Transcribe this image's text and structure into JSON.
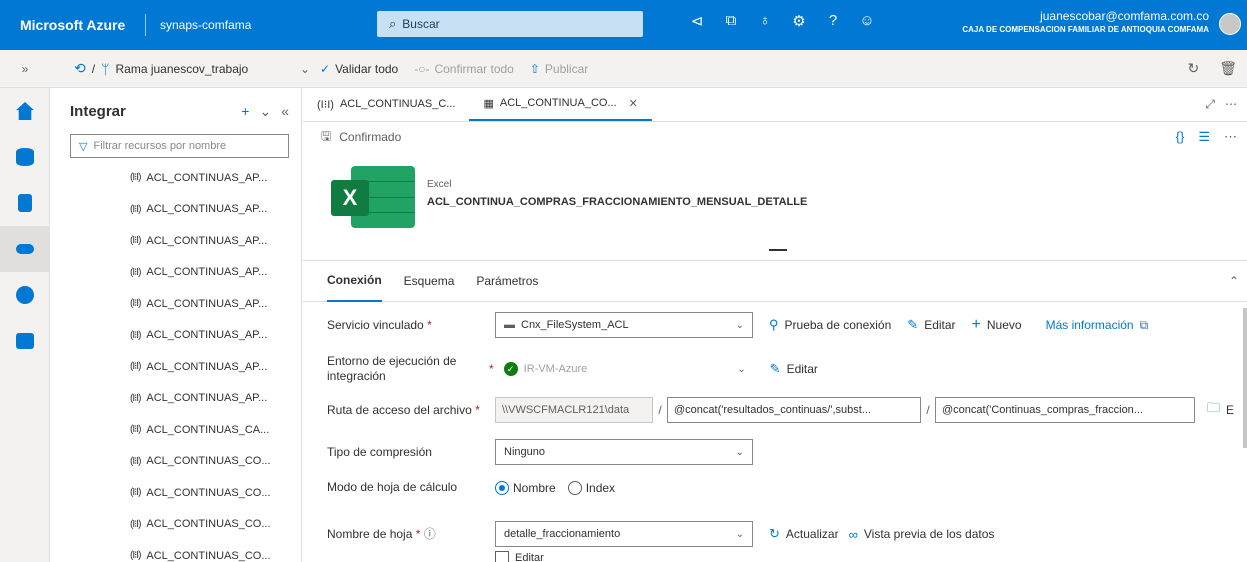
{
  "topbar": {
    "brand": "Microsoft Azure",
    "workspace": "synaps-comfama",
    "search_placeholder": "Buscar",
    "email": "juanescobar@comfama.com.co",
    "org": "CAJA DE COMPENSACION FAMILIAR DE ANTIOQUIA COMFAMA"
  },
  "toolbar": {
    "branch_prefix": "/",
    "branch": "Rama juanescov_trabajo",
    "validate_all": "Validar todo",
    "commit_all": "Confirmar todo",
    "publish": "Publicar"
  },
  "resources": {
    "title": "Integrar",
    "filter_placeholder": "Filtrar recursos por nombre",
    "items": [
      "ACL_CONTINUAS_AP...",
      "ACL_CONTINUAS_AP...",
      "ACL_CONTINUAS_AP...",
      "ACL_CONTINUAS_AP...",
      "ACL_CONTINUAS_AP...",
      "ACL_CONTINUAS_AP...",
      "ACL_CONTINUAS_AP...",
      "ACL_CONTINUAS_AP...",
      "ACL_CONTINUAS_CA...",
      "ACL_CONTINUAS_CO...",
      "ACL_CONTINUAS_CO...",
      "ACL_CONTINUAS_CO...",
      "ACL_CONTINUAS_CO..."
    ]
  },
  "tabs": [
    {
      "label": "ACL_CONTINUAS_C..."
    },
    {
      "label": "ACL_CONTINUA_CO..."
    }
  ],
  "status": "Confirmado",
  "dataset": {
    "type": "Excel",
    "name": "ACL_CONTINUA_COMPRAS_FRACCIONAMIENTO_MENSUAL_DETALLE"
  },
  "subtabs": [
    "Conexión",
    "Esquema",
    "Parámetros"
  ],
  "form": {
    "linked_service": {
      "label": "Servicio vinculado",
      "value": "Cnx_FileSystem_ACL",
      "test": "Prueba de conexión",
      "edit": "Editar",
      "new": "Nuevo",
      "more": "Más información"
    },
    "runtime": {
      "label": "Entorno de ejecución de integración",
      "value": "IR-VM-Azure",
      "edit": "Editar"
    },
    "path": {
      "label": "Ruta de acceso del archivo",
      "root": "\\\\VWSCFMACLR121\\data",
      "dir": "@concat('resultados_continuas/',subst...",
      "file": "@concat('Continuas_compras_fraccion...",
      "browse": "E"
    },
    "compression": {
      "label": "Tipo de compresión",
      "value": "Ninguno"
    },
    "sheet_mode": {
      "label": "Modo de hoja de cálculo",
      "opt1": "Nombre",
      "opt2": "Index"
    },
    "sheet_name": {
      "label": "Nombre de hoja",
      "value": "detalle_fraccionamiento",
      "refresh": "Actualizar",
      "preview": "Vista previa de los datos",
      "edit": "Editar"
    }
  }
}
